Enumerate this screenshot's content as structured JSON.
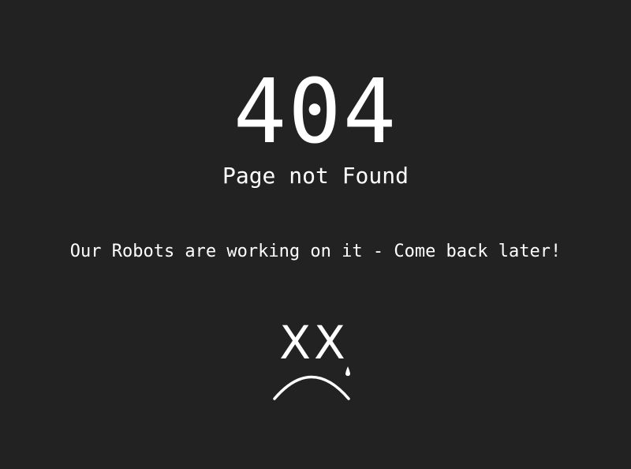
{
  "error": {
    "code": "404",
    "title": "Page not Found",
    "message": "Our Robots are working on it - Come back later!"
  },
  "face": {
    "eyes": "XX",
    "icon": "sad-robot-face-icon",
    "color": "#ffffff"
  },
  "colors": {
    "background": "#222222",
    "text": "#ffffff"
  }
}
